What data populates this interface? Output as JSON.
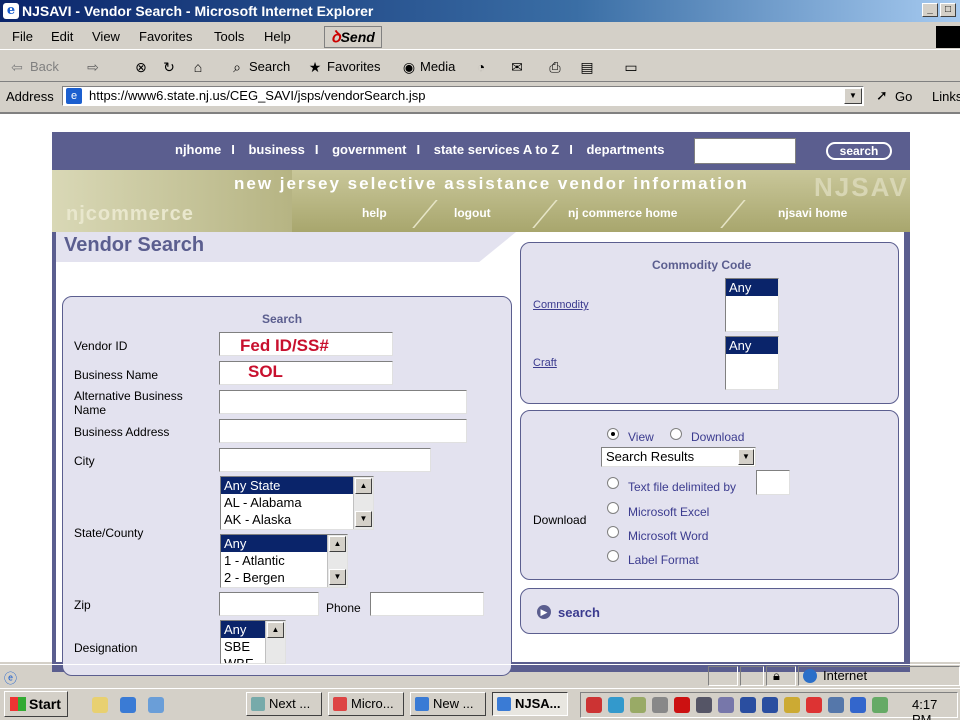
{
  "window": {
    "title": "NJSAVI - Vendor Search - Microsoft Internet Explorer"
  },
  "menu": [
    "File",
    "Edit",
    "View",
    "Favorites",
    "Tools",
    "Help"
  ],
  "send_label": "Send",
  "toolbar": {
    "back": "Back",
    "search": "Search",
    "favorites": "Favorites",
    "media": "Media"
  },
  "address": {
    "label": "Address",
    "url": "https://www6.state.nj.us/CEG_SAVI/jsps/vendorSearch.jsp",
    "go": "Go",
    "links": "Links"
  },
  "site": {
    "topnav": [
      "njhome",
      "business",
      "government",
      "state services A to Z",
      "departments"
    ],
    "topnav_sep": "I",
    "search_btn": "search",
    "banner_title": "new jersey selective assistance vendor information",
    "banner_ghost": "NJSAVI",
    "logo": "njcommerce",
    "banner_links": [
      "help",
      "logout",
      "nj commerce home",
      "njsavi home"
    ]
  },
  "page": {
    "heading": "Vendor Search"
  },
  "search_panel": {
    "heading": "Search",
    "vendor_id_label": "Vendor ID",
    "vendor_id_overlay": "Fed ID/SS#",
    "business_name_label": "Business Name",
    "business_name_overlay": "SOL",
    "alt_name_label": "Alternative Business Name",
    "address_label": "Business Address",
    "city_label": "City",
    "state_county_label": "State/County",
    "states": [
      "Any State",
      "AL - Alabama",
      "AK - Alaska"
    ],
    "counties": [
      "Any",
      "1 - Atlantic",
      "2 - Bergen"
    ],
    "zip_label": "Zip",
    "phone_label": "Phone",
    "designation_label": "Designation",
    "designations": [
      "Any",
      "SBE",
      "WBE"
    ]
  },
  "commodity_panel": {
    "heading": "Commodity Code",
    "commodity_link": "Commodity",
    "craft_link": "Craft",
    "commodity_value": "Any",
    "craft_value": "Any"
  },
  "download_panel": {
    "label": "Download",
    "view": "View",
    "download": "Download",
    "select_value": "Search Results",
    "options": [
      "Text file delimited by",
      "Microsoft Excel",
      "Microsoft Word",
      "Label Format"
    ]
  },
  "search_action": "search",
  "status": {
    "zone": "Internet"
  },
  "taskbar": {
    "start": "Start",
    "buttons": [
      "Next ...",
      "Micro...",
      "New ...",
      "NJSA..."
    ],
    "clock": "4:17 PM"
  }
}
